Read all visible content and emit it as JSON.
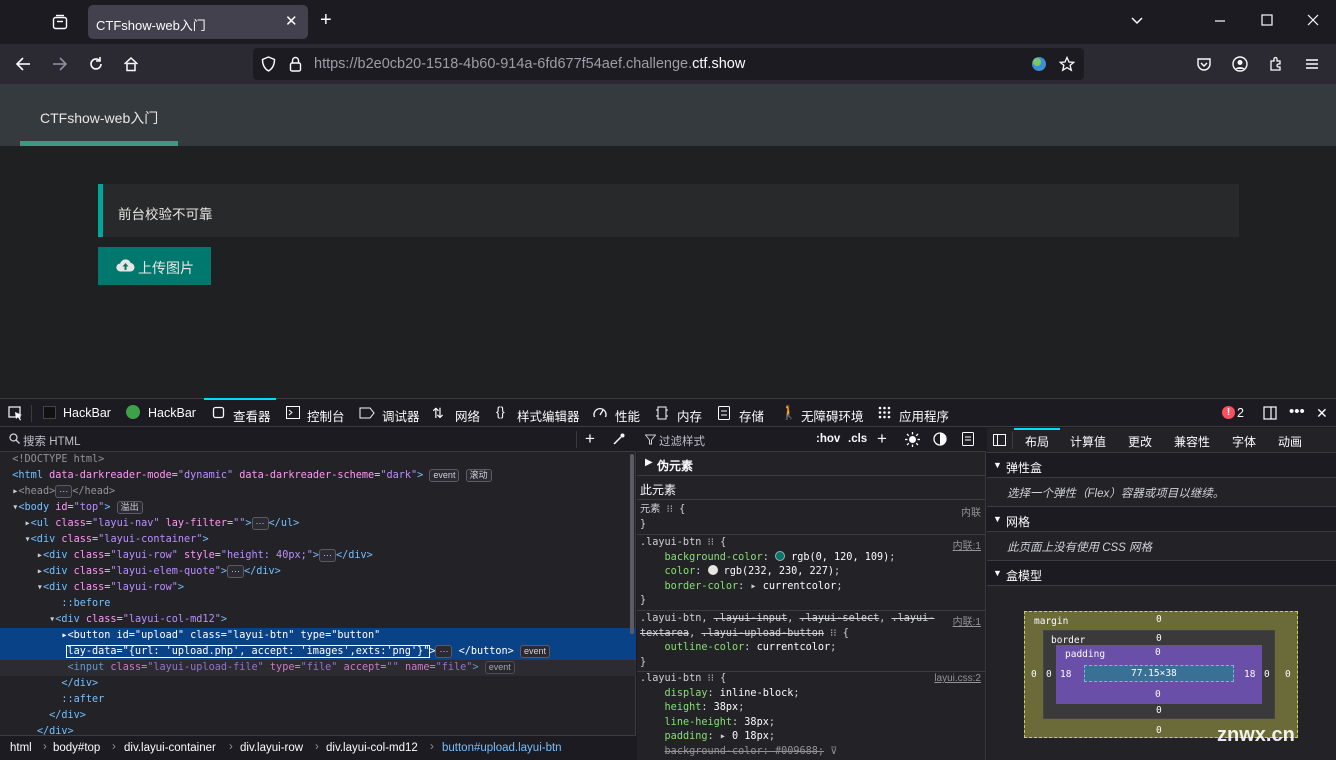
{
  "browser": {
    "tab_title": "CTFshow-web入门",
    "url_prefix": "https://b2e0cb20-1518-4b60-914a-6fd677f54aef.challenge.",
    "url_domain": "ctf.show"
  },
  "page": {
    "nav_item": "CTFshow-web入门",
    "quote_text": "前台校验不可靠",
    "upload_label": "上传图片"
  },
  "devtools": {
    "tools": [
      "HackBar",
      "HackBar",
      "查看器",
      "控制台",
      "调试器",
      "网络",
      "样式编辑器",
      "性能",
      "内存",
      "存储",
      "无障碍环境",
      "应用程序"
    ],
    "error_count": "2",
    "search_placeholder": "搜索 HTML",
    "filter_placeholder": "过滤样式",
    "hov": ":hov",
    "cls": ".cls",
    "breadcrumbs": [
      "html",
      "body#top",
      "div.layui-container",
      "div.layui-row",
      "div.layui-col-md12",
      "button#upload.layui-btn"
    ],
    "right_tabs": [
      "布局",
      "计算值",
      "更改",
      "兼容性",
      "字体",
      "动画"
    ],
    "flex_title": "弹性盒",
    "flex_note": "选择一个弹性（Flex）容器或项目以继续。",
    "grid_title": "网格",
    "grid_note": "此页面上没有使用 CSS 网格",
    "boxmodel_title": "盒模型",
    "box": {
      "margin_label": "margin",
      "border_label": "border",
      "padding_label": "padding",
      "content": "77.15×38",
      "padding_lr": "18",
      "zero": "0"
    },
    "pseudo_title": "伪元素",
    "this_element": "此元素",
    "inline": "内联",
    "inline_1": "内联:1",
    "layui_css": "layui.css:2"
  },
  "watermark": "znwx.cn"
}
